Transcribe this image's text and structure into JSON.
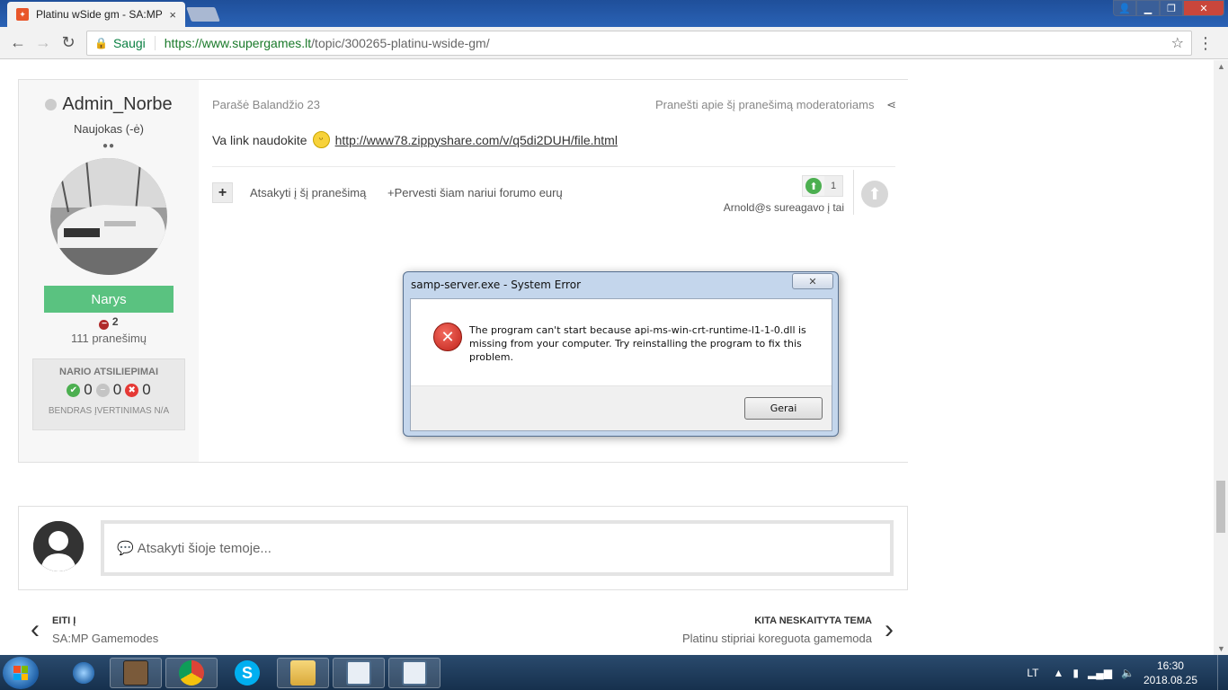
{
  "browser": {
    "tab_title": "Platinu wSide gm - SA:MP",
    "tab_close": "×",
    "secure_label": "Saugi",
    "url_domain": "https://www.supergames.lt",
    "url_path": "/topic/300265-platinu-wside-gm/"
  },
  "author": {
    "name": "Admin_Norbe",
    "rank": "Naujokas (-ė)",
    "group": "Narys",
    "reputation": "2",
    "posts": "111 pranešimų",
    "feedback_title": "NARIO ATSILIEPIMAI",
    "feedback_positive": "0",
    "feedback_neutral": "0",
    "feedback_negative": "0",
    "feedback_overall": "BENDRAS ĮVERTINIMAS N/A"
  },
  "post": {
    "date": "Parašė Balandžio 23",
    "report": "Pranešti apie šį pranešimą moderatoriams",
    "content_text": "Va link naudokite",
    "link": "http://www78.zippyshare.com/v/q5di2DUH/file.html",
    "quote_action": "Atsakyti į šį pranešimą",
    "donate_action": "+Pervesti šiam nariui forumo eurų",
    "reaction_count": "1",
    "reaction_by": "Arnold@s sureagavo į tai"
  },
  "reply": {
    "placeholder": "Atsakyti šioje temoje..."
  },
  "navigation": {
    "prev_label": "EITI Į",
    "prev_title": "SA:MP Gamemodes",
    "next_label": "KITA NESKAITYTA TEMA",
    "next_title": "Platinu stipriai koreguota gamemoda"
  },
  "dialog": {
    "title": "samp-server.exe - System Error",
    "message": "The program can't start because api-ms-win-crt-runtime-l1-1-0.dll is missing from your computer. Try reinstalling the program to fix this problem.",
    "ok_label": "Gerai"
  },
  "taskbar": {
    "language": "LT",
    "time": "16:30",
    "date": "2018.08.25"
  },
  "colors": {
    "group_badge": "#5ac280",
    "taskbar": "#1f3a5a",
    "error_icon": "#d3302a"
  }
}
